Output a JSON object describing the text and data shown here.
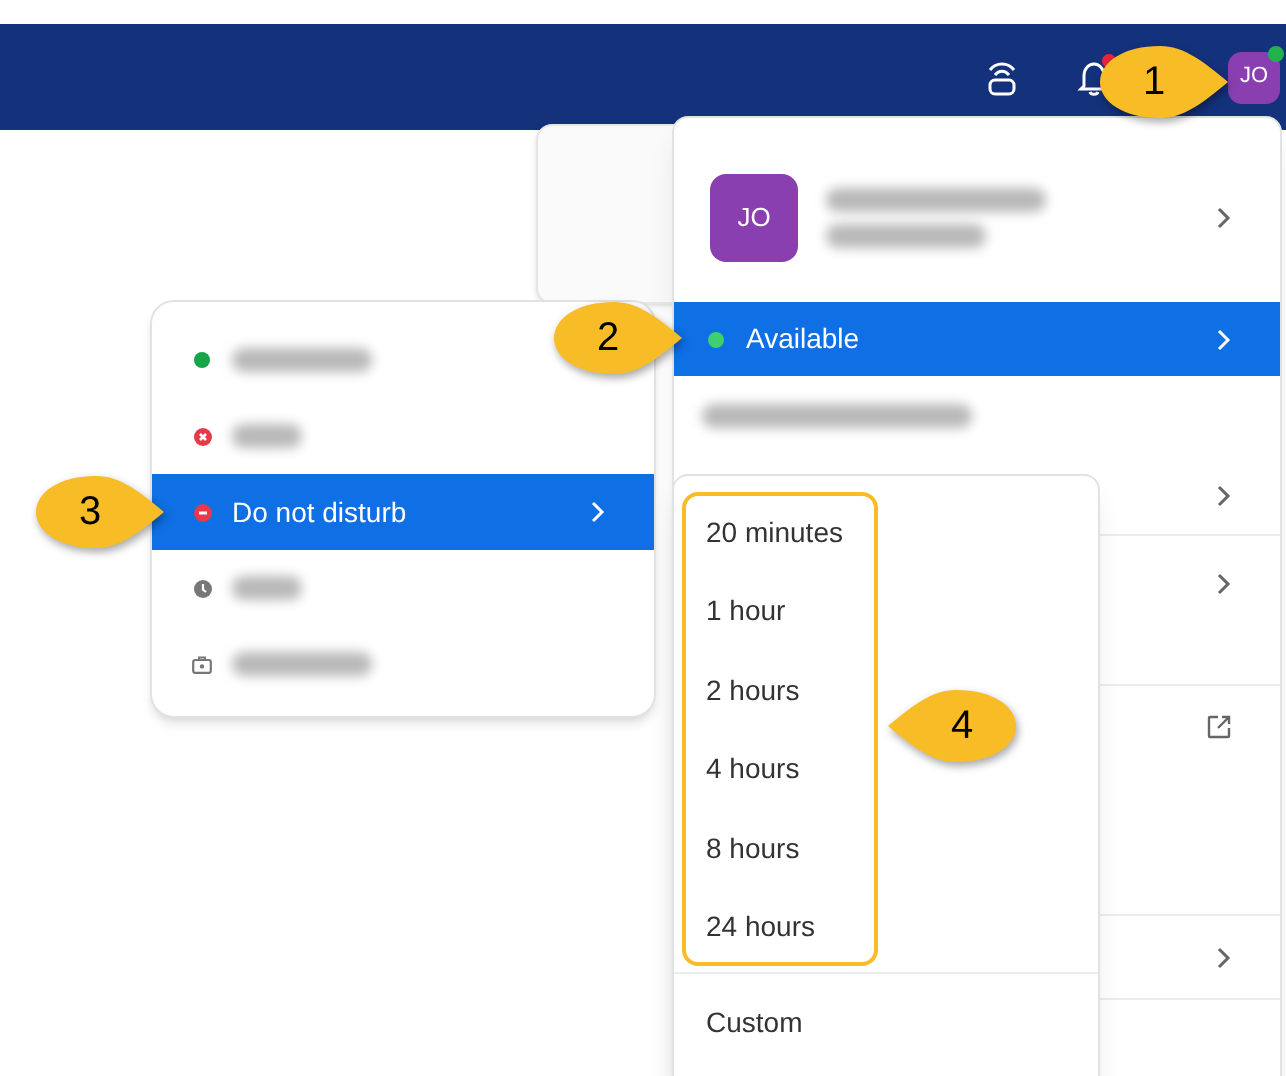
{
  "top_bar": {
    "notification_badge": true,
    "avatar": {
      "initials": "JO",
      "online": true
    }
  },
  "profile_menu": {
    "avatar_initials": "JO",
    "status_item": {
      "label": "Available",
      "selected": true,
      "color": "#3ecf6e"
    },
    "rows": [
      {
        "kind": "submenu"
      },
      {
        "kind": "submenu"
      },
      {
        "kind": "external"
      },
      {
        "kind": "submenu"
      }
    ]
  },
  "status_menu": {
    "items": [
      {
        "kind": "available",
        "selected": false
      },
      {
        "kind": "busy",
        "selected": false
      },
      {
        "kind": "dnd",
        "label": "Do not disturb",
        "selected": true
      },
      {
        "kind": "away",
        "selected": false
      },
      {
        "kind": "offline",
        "selected": false
      }
    ]
  },
  "duration_menu": {
    "items": [
      "20 minutes",
      "1 hour",
      "2 hours",
      "4 hours",
      "8 hours",
      "24 hours"
    ],
    "custom": "Custom"
  },
  "callouts": [
    {
      "number": "1",
      "kind": "right"
    },
    {
      "number": "2",
      "kind": "right"
    },
    {
      "number": "3",
      "kind": "right"
    },
    {
      "number": "4",
      "kind": "left"
    }
  ]
}
